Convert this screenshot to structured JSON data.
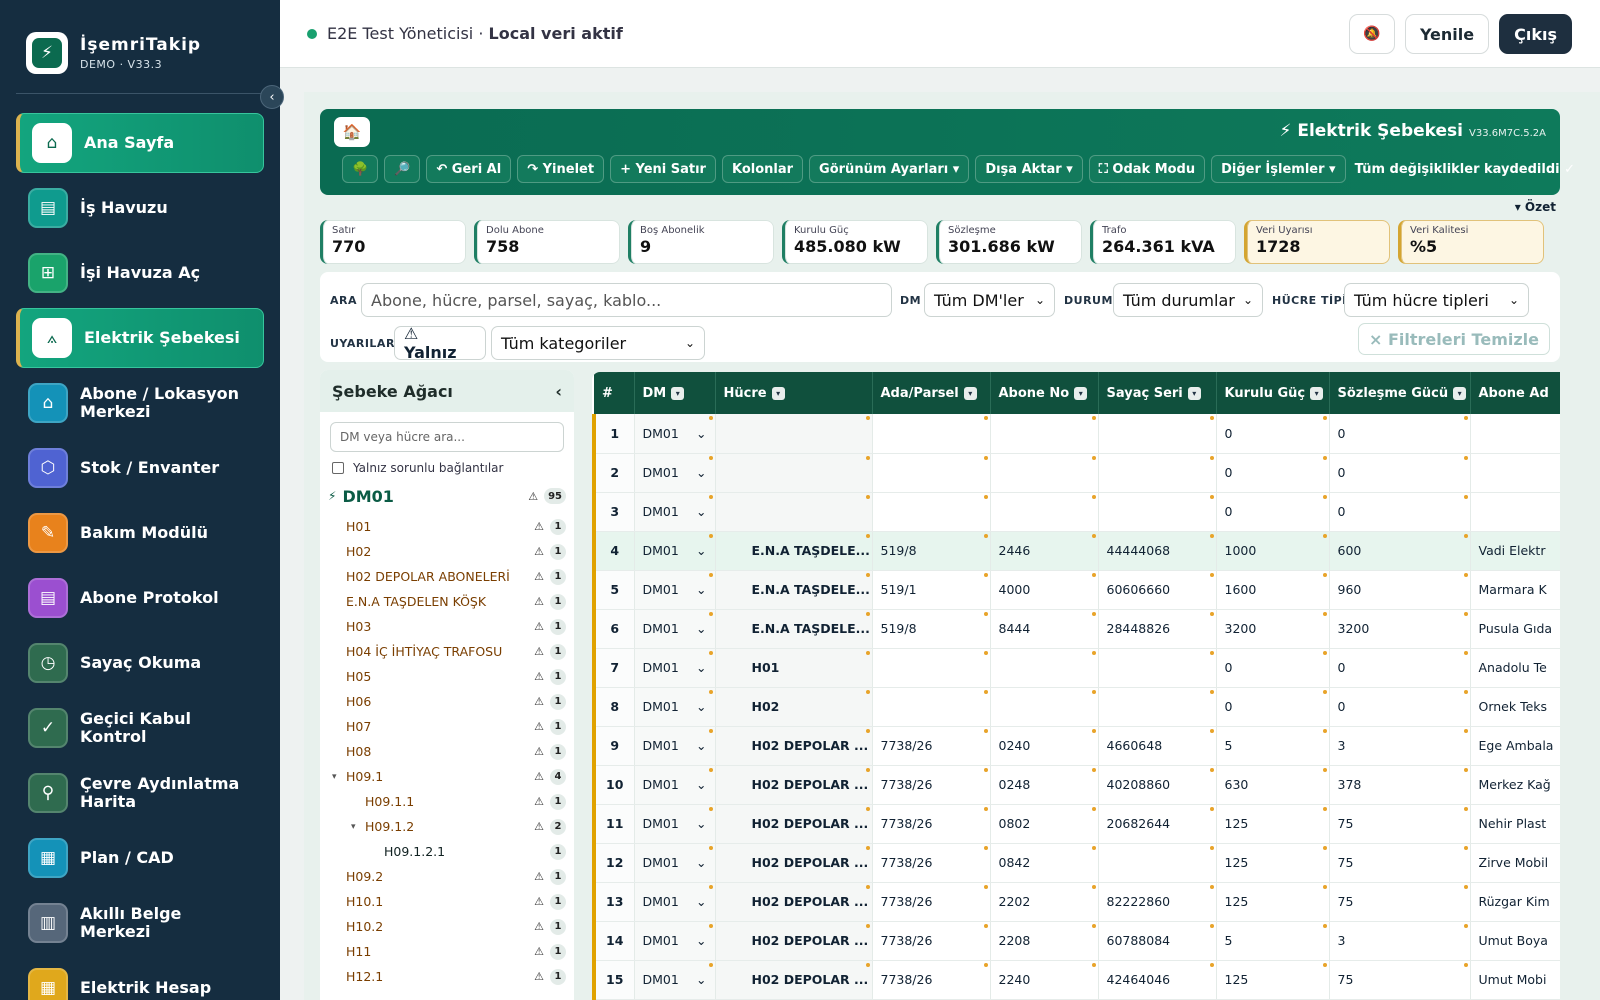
{
  "app": {
    "title": "İşemriTakip",
    "version": "DEMO · V33.3"
  },
  "sidebar": {
    "items": [
      {
        "label": "Ana Sayfa",
        "icon": "home-icon",
        "glyph": "⌂",
        "color": "#0e8a68",
        "active": true
      },
      {
        "label": "İş Havuzu",
        "icon": "clipboard-icon",
        "glyph": "▤",
        "color": "#0f9b8e",
        "active": false
      },
      {
        "label": "İşi Havuza Aç",
        "icon": "plus-doc-icon",
        "glyph": "⊞",
        "color": "#1aa36b",
        "active": false
      },
      {
        "label": "Elektrik Şebekesi",
        "icon": "pylon-icon",
        "glyph": "⟑",
        "color": "#0e8a68",
        "active": true
      },
      {
        "label": "Abone / Lokasyon Merkezi",
        "icon": "building-icon",
        "glyph": "⌂",
        "color": "#1492b8",
        "active": false
      },
      {
        "label": "Stok / Envanter",
        "icon": "box-icon",
        "glyph": "⬡",
        "color": "#4f63d2",
        "active": false
      },
      {
        "label": "Bakım Modülü",
        "icon": "wrench-icon",
        "glyph": "✎",
        "color": "#e8821c",
        "active": false
      },
      {
        "label": "Abone Protokol",
        "icon": "document-icon",
        "glyph": "▤",
        "color": "#9b4fd0",
        "active": false
      },
      {
        "label": "Sayaç Okuma",
        "icon": "meter-icon",
        "glyph": "◷",
        "color": "#2f6b4f",
        "active": false
      },
      {
        "label": "Geçici Kabul Kontrol",
        "icon": "check-doc-icon",
        "glyph": "✓",
        "color": "#2f6b4f",
        "active": false
      },
      {
        "label": "Çevre Aydınlatma Harita",
        "icon": "map-pin-icon",
        "glyph": "⚲",
        "color": "#2f6b4f",
        "active": false
      },
      {
        "label": "Plan / CAD",
        "icon": "blueprint-icon",
        "glyph": "▦",
        "color": "#1492b8",
        "active": false
      },
      {
        "label": "Akıllı Belge Merkezi",
        "icon": "file-stack-icon",
        "glyph": "▥",
        "color": "#56677a",
        "active": false
      },
      {
        "label": "Elektrik Hesap",
        "icon": "calculator-icon",
        "glyph": "▦",
        "color": "#e0a81c",
        "active": false
      }
    ]
  },
  "topbar": {
    "user": "E2E Test Yöneticisi",
    "separator": " · ",
    "mode": "Local veri aktif",
    "refresh": "Yenile",
    "logout": "Çıkış"
  },
  "header": {
    "title": "⚡ Elektrik Şebekesi",
    "version": "V33.6M7C.5.2A",
    "toolbar": [
      {
        "label": "🌳",
        "name": "tree-toggle-button"
      },
      {
        "label": "🔎",
        "name": "inspect-button"
      },
      {
        "label": "↶ Geri Al",
        "name": "undo-button"
      },
      {
        "label": "↷ Yinelet",
        "name": "redo-button"
      },
      {
        "label": "+ Yeni Satır",
        "name": "new-row-button"
      },
      {
        "label": "Kolonlar",
        "name": "columns-button"
      },
      {
        "label": "Görünüm Ayarları ▾",
        "name": "view-settings-button"
      },
      {
        "label": "Dışa Aktar ▾",
        "name": "export-button"
      },
      {
        "label": "⛶ Odak Modu",
        "name": "focus-mode-button"
      },
      {
        "label": "Diğer İşlemler ▾",
        "name": "more-actions-button"
      }
    ],
    "saved": "Tüm değişiklikler kaydedildi ✓"
  },
  "summary_toggle": "▾ Özet",
  "stats": [
    {
      "label": "Satır",
      "value": "770",
      "warn": false
    },
    {
      "label": "Dolu Abone",
      "value": "758",
      "warn": false
    },
    {
      "label": "Boş Abonelik",
      "value": "9",
      "warn": false
    },
    {
      "label": "Kurulu Güç",
      "value": "485.080 kW",
      "warn": false
    },
    {
      "label": "Sözleşme",
      "value": "301.686 kW",
      "warn": false
    },
    {
      "label": "Trafo",
      "value": "264.361 kVA",
      "warn": false
    },
    {
      "label": "Veri Uyarısı",
      "value": "1728",
      "warn": true
    },
    {
      "label": "Veri Kalitesi",
      "value": "%5",
      "warn": true
    }
  ],
  "filters": {
    "search_label": "ARA",
    "search_placeholder": "Abone, hücre, parsel, sayaç, kablo...",
    "dm_label": "DM",
    "dm_value": "Tüm DM'ler",
    "status_label": "DURUM",
    "status_value": "Tüm durumlar",
    "cell_type_label": "HÜCRE TİPİ",
    "cell_type_value": "Tüm hücre tipleri",
    "warnings_label": "UYARILAR",
    "only_label": "⚠ Yalnız",
    "category_value": "Tüm kategoriler",
    "clear_label": "× Filtreleri Temizle"
  },
  "tree": {
    "title": "Şebeke Ağacı",
    "search_placeholder": "DM veya hücre ara...",
    "only_problem": "Yalnız sorunlu bağlantılar",
    "root": {
      "name": "DM01",
      "count": "95"
    },
    "nodes": [
      {
        "name": "H01",
        "count": "1",
        "level": 0,
        "expander": ""
      },
      {
        "name": "H02",
        "count": "1",
        "level": 0,
        "expander": ""
      },
      {
        "name": "H02 DEPOLAR ABONELERİ",
        "count": "1",
        "level": 0,
        "expander": ""
      },
      {
        "name": "E.N.A TAŞDELEN KÖŞK",
        "count": "1",
        "level": 0,
        "expander": ""
      },
      {
        "name": "H03",
        "count": "1",
        "level": 0,
        "expander": ""
      },
      {
        "name": "H04 İÇ İHTİYAÇ TRAFOSU",
        "count": "1",
        "level": 0,
        "expander": ""
      },
      {
        "name": "H05",
        "count": "1",
        "level": 0,
        "expander": ""
      },
      {
        "name": "H06",
        "count": "1",
        "level": 0,
        "expander": ""
      },
      {
        "name": "H07",
        "count": "1",
        "level": 0,
        "expander": ""
      },
      {
        "name": "H08",
        "count": "1",
        "level": 0,
        "expander": ""
      },
      {
        "name": "H09.1",
        "count": "4",
        "level": 0,
        "expander": "▾"
      },
      {
        "name": "H09.1.1",
        "count": "1",
        "level": 1,
        "expander": ""
      },
      {
        "name": "H09.1.2",
        "count": "2",
        "level": 1,
        "expander": "▾"
      },
      {
        "name": "H09.1.2.1",
        "count": "1",
        "level": 2,
        "expander": ""
      },
      {
        "name": "H09.2",
        "count": "1",
        "level": 0,
        "expander": ""
      },
      {
        "name": "H10.1",
        "count": "1",
        "level": 0,
        "expander": ""
      },
      {
        "name": "H10.2",
        "count": "1",
        "level": 0,
        "expander": ""
      },
      {
        "name": "H11",
        "count": "1",
        "level": 0,
        "expander": ""
      },
      {
        "name": "H12.1",
        "count": "1",
        "level": 0,
        "expander": ""
      }
    ]
  },
  "grid": {
    "columns": [
      "#",
      "DM",
      "Hücre",
      "Ada/Parsel",
      "Abone No",
      "Sayaç Seri",
      "Kurulu Güç",
      "Sözleşme Gücü",
      "Abone Ad"
    ],
    "rows": [
      [
        "1",
        "DM01",
        "",
        "",
        "",
        "",
        "0",
        "0",
        ""
      ],
      [
        "2",
        "DM01",
        "",
        "",
        "",
        "",
        "0",
        "0",
        ""
      ],
      [
        "3",
        "DM01",
        "",
        "",
        "",
        "",
        "0",
        "0",
        ""
      ],
      [
        "4",
        "DM01",
        "E.N.A TAŞDELE...",
        "519/8",
        "2446",
        "44444068",
        "1000",
        "600",
        "Vadi Elektr"
      ],
      [
        "5",
        "DM01",
        "E.N.A TAŞDELE...",
        "519/1",
        "4000",
        "60606660",
        "1600",
        "960",
        "Marmara K"
      ],
      [
        "6",
        "DM01",
        "E.N.A TAŞDELE...",
        "519/8",
        "8444",
        "28448826",
        "3200",
        "3200",
        "Pusula Gıda"
      ],
      [
        "7",
        "DM01",
        "H01",
        "",
        "",
        "",
        "0",
        "0",
        "Anadolu Te"
      ],
      [
        "8",
        "DM01",
        "H02",
        "",
        "",
        "",
        "0",
        "0",
        "Ornek Teks"
      ],
      [
        "9",
        "DM01",
        "H02 DEPOLAR ...",
        "7738/26",
        "0240",
        "4660648",
        "5",
        "3",
        "Ege Ambala"
      ],
      [
        "10",
        "DM01",
        "H02 DEPOLAR ...",
        "7738/26",
        "0248",
        "40208860",
        "630",
        "378",
        "Merkez Kağ"
      ],
      [
        "11",
        "DM01",
        "H02 DEPOLAR ...",
        "7738/26",
        "0802",
        "20682644",
        "125",
        "75",
        "Nehir Plast"
      ],
      [
        "12",
        "DM01",
        "H02 DEPOLAR ...",
        "7738/26",
        "0842",
        "",
        "125",
        "75",
        "Zirve Mobil"
      ],
      [
        "13",
        "DM01",
        "H02 DEPOLAR ...",
        "7738/26",
        "2202",
        "82222860",
        "125",
        "75",
        "Rüzgar Kim"
      ],
      [
        "14",
        "DM01",
        "H02 DEPOLAR ...",
        "7738/26",
        "2208",
        "60788084",
        "5",
        "3",
        "Umut Boya"
      ],
      [
        "15",
        "DM01",
        "H02 DEPOLAR ...",
        "7738/26",
        "2240",
        "42464046",
        "125",
        "75",
        "Umut Mobi"
      ]
    ]
  }
}
